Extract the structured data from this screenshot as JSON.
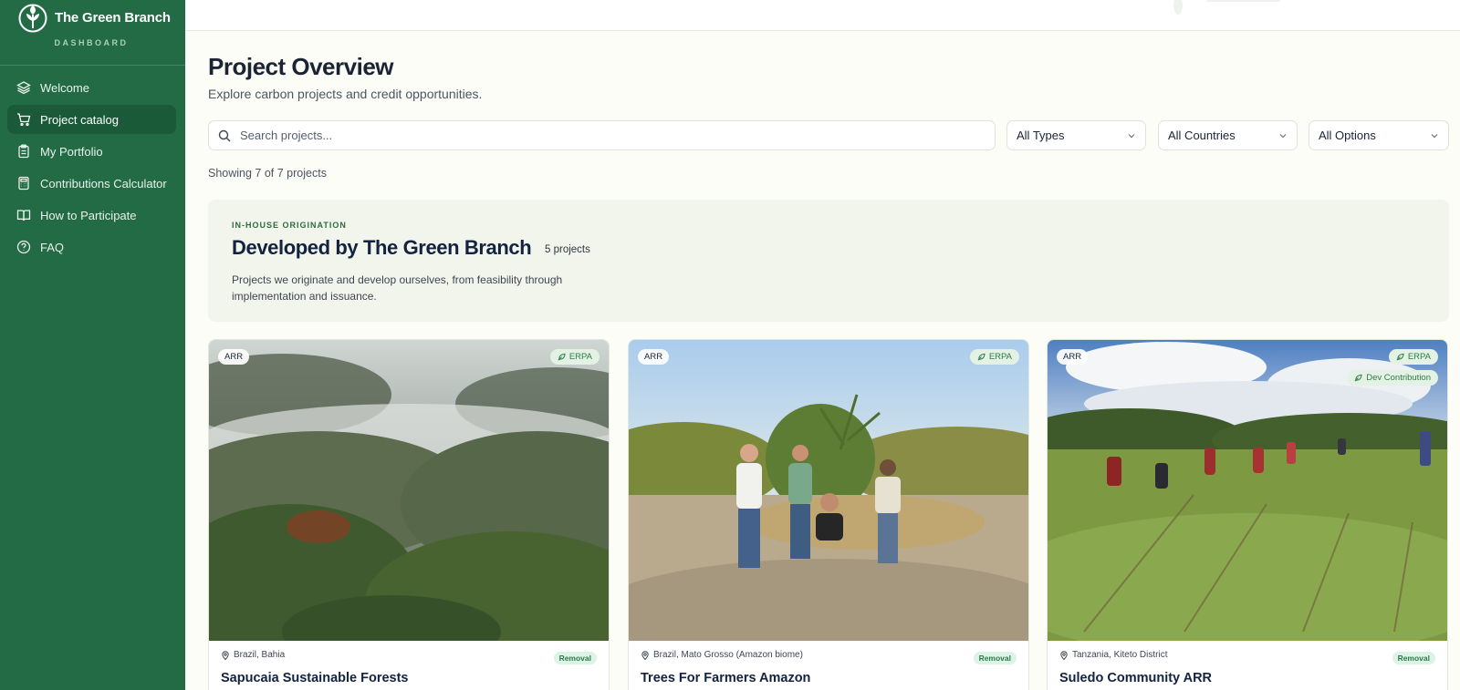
{
  "brand": {
    "name": "The Green Branch",
    "subtitle": "DASHBOARD"
  },
  "sidebar": {
    "items": [
      {
        "label": "Welcome",
        "icon": "layers-icon",
        "active": false
      },
      {
        "label": "Project catalog",
        "icon": "cart-icon",
        "active": true
      },
      {
        "label": "My Portfolio",
        "icon": "clipboard-icon",
        "active": false
      },
      {
        "label": "Contributions Calculator",
        "icon": "calculator-icon",
        "active": false
      },
      {
        "label": "How to Participate",
        "icon": "book-icon",
        "active": false
      },
      {
        "label": "FAQ",
        "icon": "help-circle-icon",
        "active": false
      }
    ]
  },
  "header": {
    "title": "Project Overview",
    "subtitle": "Explore carbon projects and credit opportunities."
  },
  "filters": {
    "search_placeholder": "Search projects...",
    "types": "All Types",
    "countries": "All Countries",
    "options": "All Options"
  },
  "results": {
    "showing": "Showing 7 of 7 projects"
  },
  "section": {
    "eyebrow": "IN-HOUSE ORIGINATION",
    "title": "Developed by The Green Branch",
    "count": "5 projects",
    "description": "Projects we originate and develop ourselves, from feasibility through implementation and issuance."
  },
  "projects": [
    {
      "type": "ARR",
      "erpa": "ERPA",
      "location": "Brazil, Bahia",
      "badge": "Removal",
      "title": "Sapucaia Sustainable Forests"
    },
    {
      "type": "ARR",
      "erpa": "ERPA",
      "location": "Brazil, Mato Grosso (Amazon biome)",
      "badge": "Removal",
      "title": "Trees For Farmers Amazon"
    },
    {
      "type": "ARR",
      "erpa": "ERPA",
      "dev": "Dev Contribution",
      "location": "Tanzania, Kiteto District",
      "badge": "Removal",
      "title": "Suledo Community ARR"
    }
  ],
  "colors": {
    "sidebar": "#226b45",
    "sidebar_active": "#1b5a39",
    "accent": "#2f7a48",
    "background": "#fdfdf7"
  }
}
